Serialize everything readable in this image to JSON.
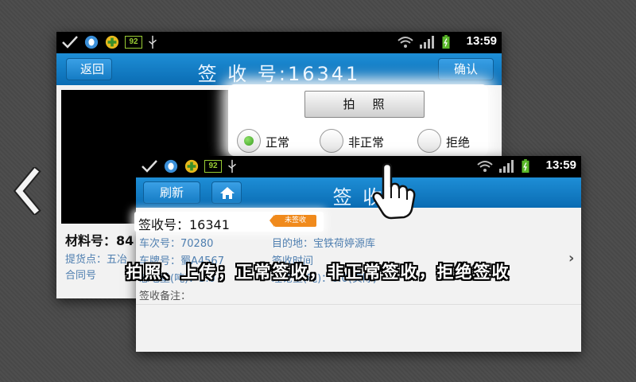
{
  "nav": {
    "prev_icon": "chevron-left-icon"
  },
  "status_bar": {
    "time": "13:59",
    "battery_badge": "92"
  },
  "back_screen": {
    "back_label": "返回",
    "title": "签 收 号:16341",
    "confirm_label": "确认",
    "material_label": "材料号：84",
    "pickup_label": "提货点：五冶",
    "contract_label": "合同号"
  },
  "popup": {
    "photo_label": "拍照",
    "options": [
      {
        "label": "正常",
        "selected": true
      },
      {
        "label": "非正常",
        "selected": false
      },
      {
        "label": "拒绝",
        "selected": false
      }
    ],
    "selected_color": "#5bc236"
  },
  "front_screen": {
    "refresh_label": "刷新",
    "title": "签 收",
    "sign_no": "签收号：16341",
    "status_tag": "未签收",
    "car_no": "车次号：70280",
    "destination": "目的地：宝铁荷婷源库",
    "plate": "车牌号：蜀A4567",
    "sign_time": "签收时间",
    "gross_weight": "总毛重(吨)：3.0",
    "net_weight": "理论重(吨)：0.0(实际)",
    "remark": "签收备注："
  },
  "caption": "拍照、上传；正常签收，非正常签收，拒绝签收",
  "colors": {
    "accent": "#0a6cb3",
    "tag": "#f08a1c",
    "info_text": "#4f7fb0"
  }
}
